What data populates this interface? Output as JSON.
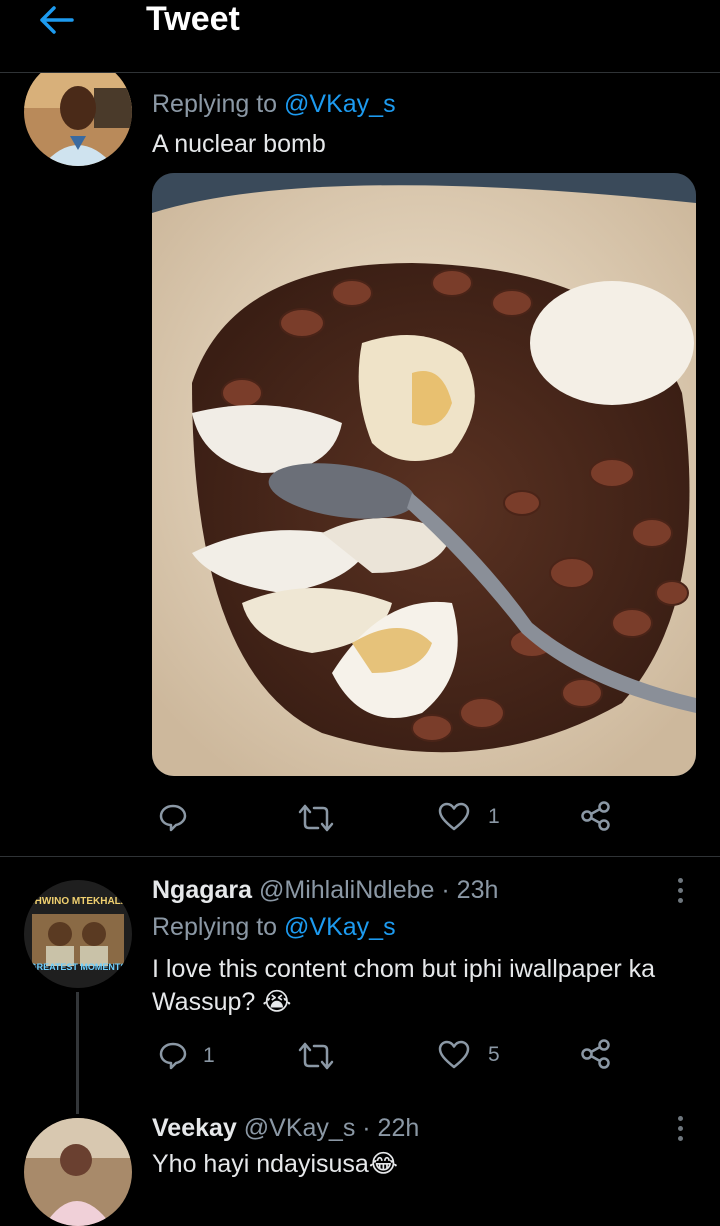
{
  "header": {
    "title": "Tweet"
  },
  "tweets": [
    {
      "reply_label": "Replying to",
      "reply_to": "@VKay_s",
      "text": "A nuclear bomb",
      "likes": "1",
      "retweets": "",
      "replies": ""
    },
    {
      "name": "Ngagara",
      "handle": "@MihlaliNdlebe · 23h",
      "reply_label": "Replying to",
      "reply_to": "@VKay_s",
      "text_line1": "I love this content chom but iphi iwallpaper ka",
      "text_line2": "Wassup? 😭",
      "avatar_text_top": "SHWINO MTEKHALA",
      "avatar_text_bottom": "GREATEST MOMENTS",
      "replies": "1",
      "likes": "5"
    },
    {
      "name": "Veekay",
      "handle": "@VKay_s · 22h",
      "text": "Yho hayi ndayisusa😂"
    }
  ],
  "colors": {
    "accent": "#1d9bf0",
    "background": "#000000",
    "muted": "#8b98a5"
  },
  "icons": [
    "back-arrow-icon",
    "reply-icon",
    "retweet-icon",
    "like-icon",
    "share-icon",
    "more-icon"
  ]
}
